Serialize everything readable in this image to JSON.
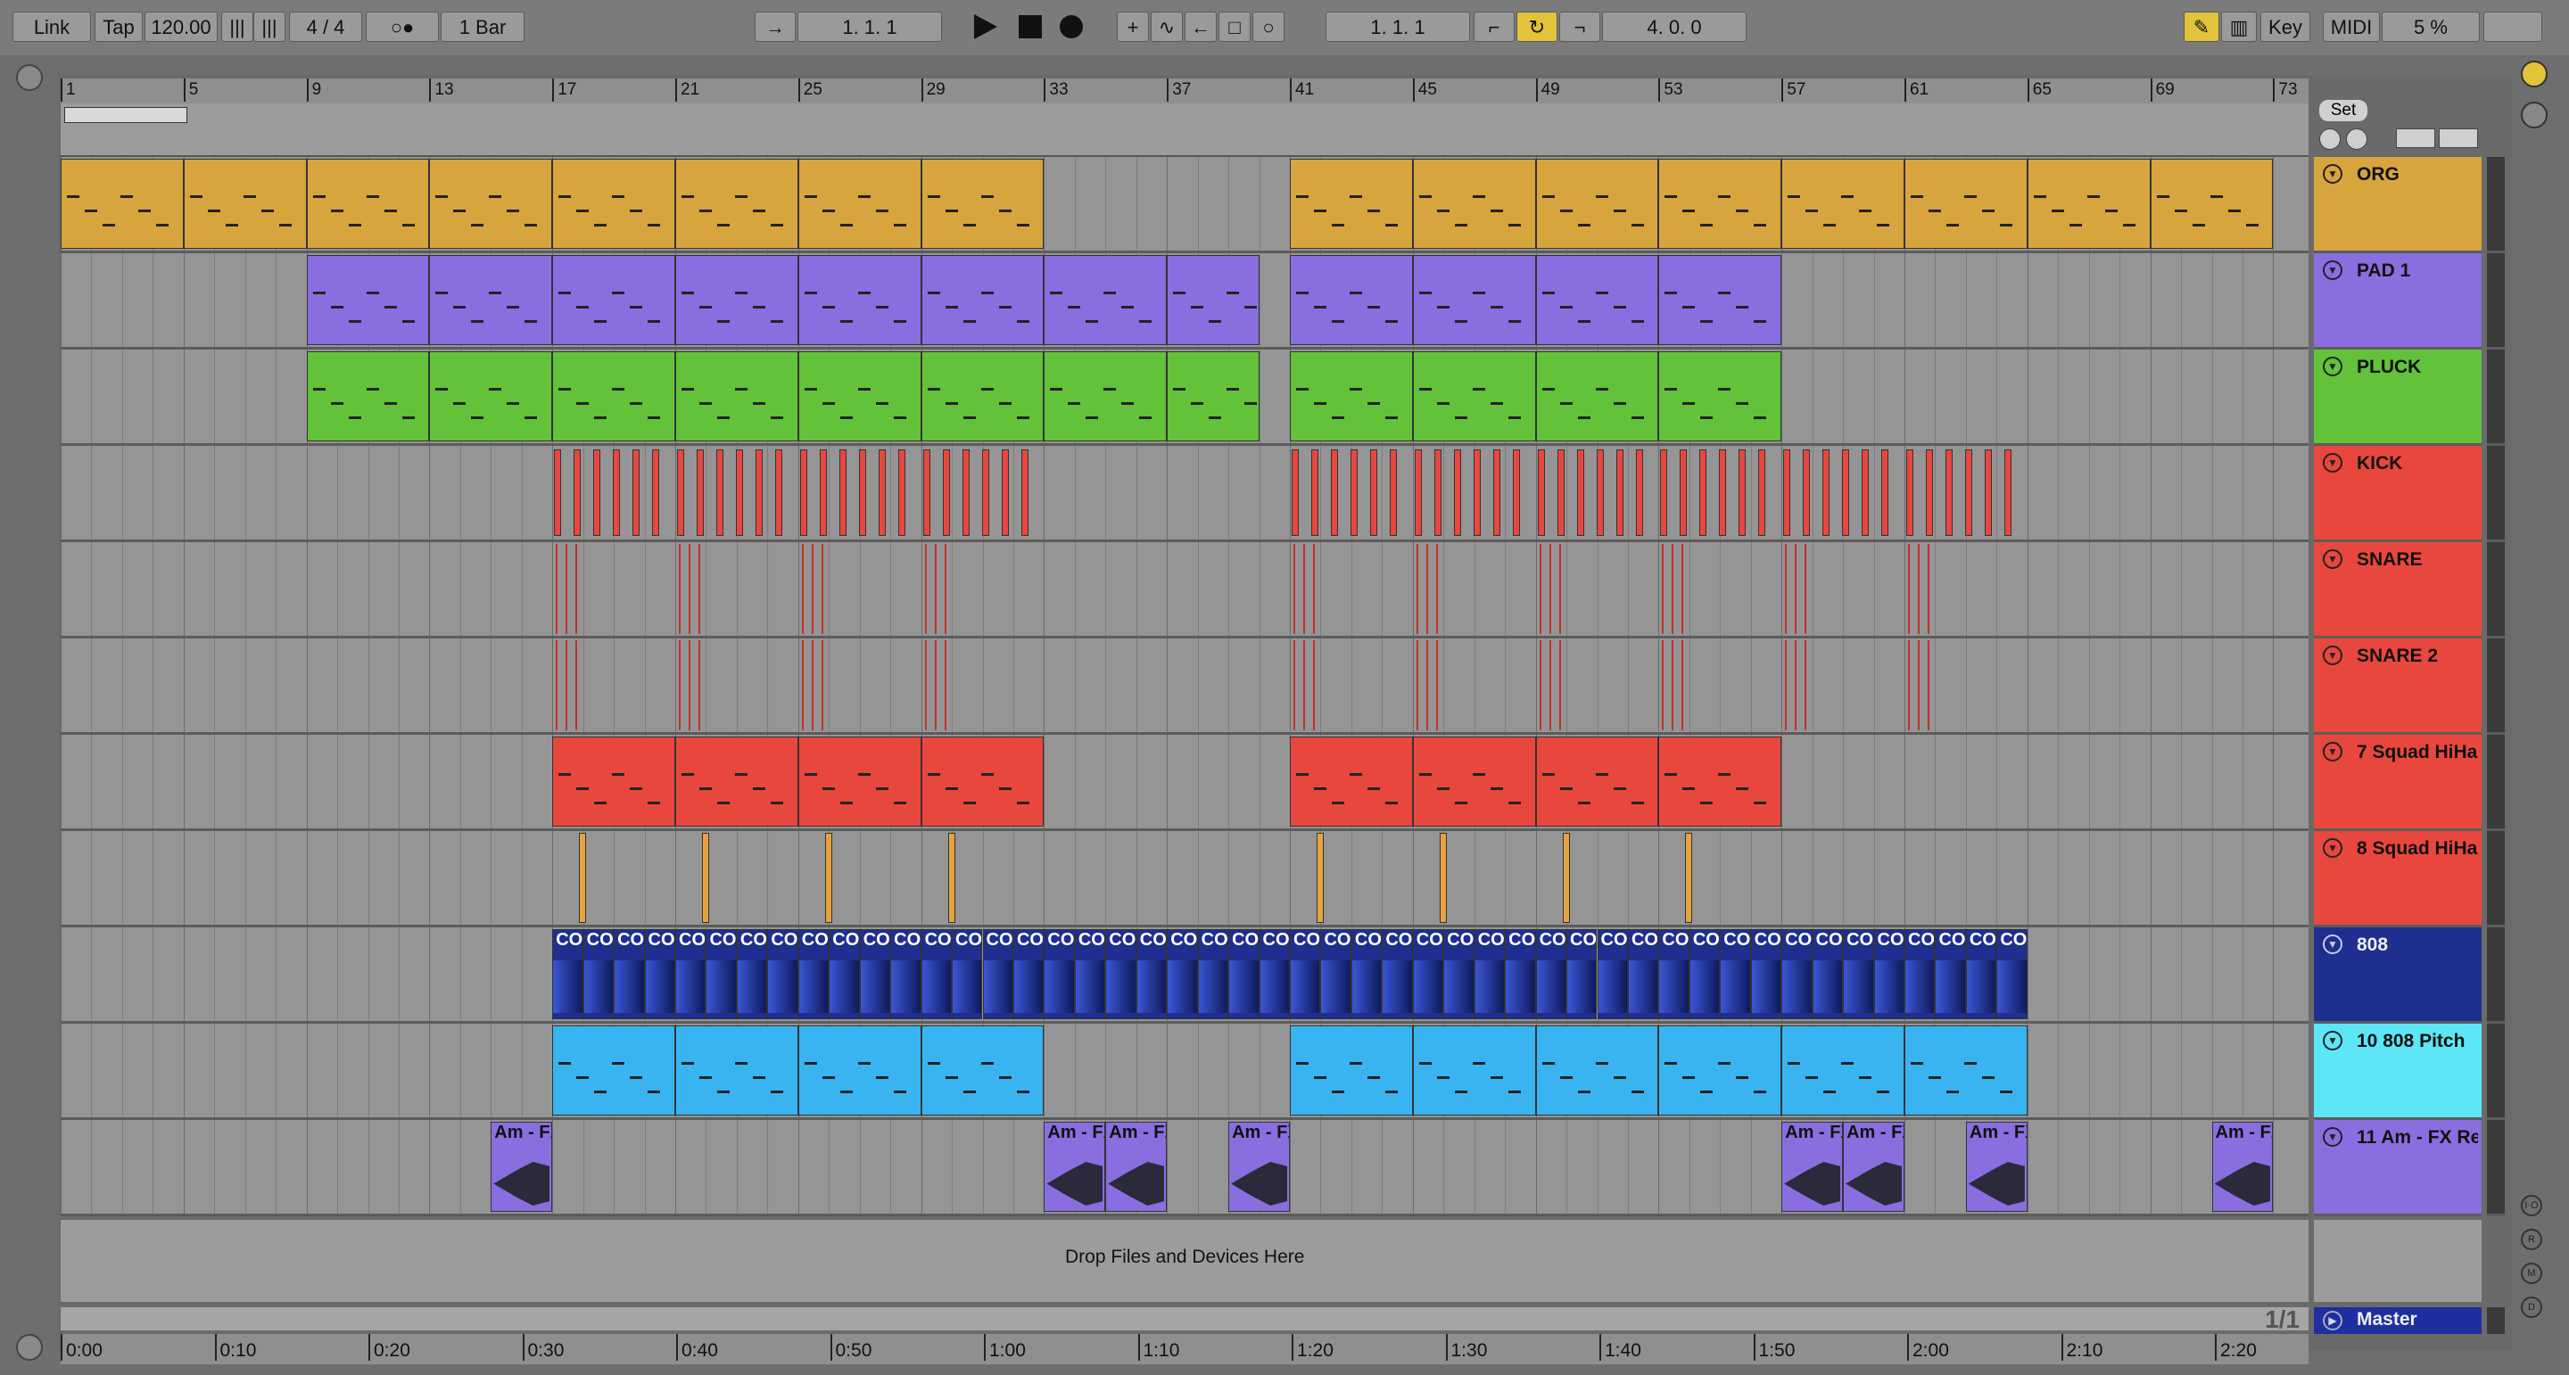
{
  "transport": {
    "link": "Link",
    "tap": "Tap",
    "tempo": "120.00",
    "time_signature": "4 / 4",
    "metro": "○●",
    "quantize": "1 Bar",
    "arrangement_position": "1.   1.   1",
    "loop_start": "1.   1.   1",
    "loop_length": "4.   0.   0",
    "key_label": "Key",
    "midi_label": "MIDI",
    "cpu": "5 %"
  },
  "ruler": {
    "bars": [
      "1",
      "5",
      "9",
      "13",
      "17",
      "21",
      "25",
      "29",
      "33",
      "37",
      "41",
      "45",
      "49",
      "53",
      "57",
      "61",
      "65",
      "69",
      "73"
    ]
  },
  "set_label": "Set",
  "tracks": [
    {
      "name": "ORG",
      "color": "#d7a43d",
      "header_color": "#d7a43d"
    },
    {
      "name": "PAD 1",
      "color": "#8a6ee0",
      "header_color": "#8a6ee0"
    },
    {
      "name": "PLUCK",
      "color": "#62c23a",
      "header_color": "#62c23a"
    },
    {
      "name": "KICK",
      "color": "#e8473d",
      "header_color": "#e8473d"
    },
    {
      "name": "SNARE",
      "color": "#e8473d",
      "header_color": "#e8473d"
    },
    {
      "name": "SNARE 2",
      "color": "#e8473d",
      "header_color": "#e8473d"
    },
    {
      "name": "7 Squad HiHa",
      "color": "#e8473d",
      "header_color": "#e8473d"
    },
    {
      "name": "8 Squad HiHa",
      "color": "#e8a23d",
      "header_color": "#e8473d"
    },
    {
      "name": "808",
      "color": "#1e2f8f",
      "header_color": "#1e2f8f"
    },
    {
      "name": "10 808 Pitch",
      "color": "#3ab4f0",
      "header_color": "#5ce6f6"
    },
    {
      "name": "11 Am - FX Re",
      "color": "#8a6ee0",
      "header_color": "#8a6ee0"
    }
  ],
  "clip_labels": {
    "co": "CO",
    "fx": "Am - FX"
  },
  "drop_text": "Drop Files and Devices Here",
  "master": "Master",
  "page_indicator": "1/1",
  "time_ruler": [
    "0:00",
    "0:10",
    "0:20",
    "0:30",
    "0:40",
    "0:50",
    "1:00",
    "1:10",
    "1:20",
    "1:30",
    "1:40",
    "1:50",
    "2:00",
    "2:10",
    "2:20"
  ],
  "io_labels": [
    "I·O",
    "R",
    "M",
    "D"
  ]
}
